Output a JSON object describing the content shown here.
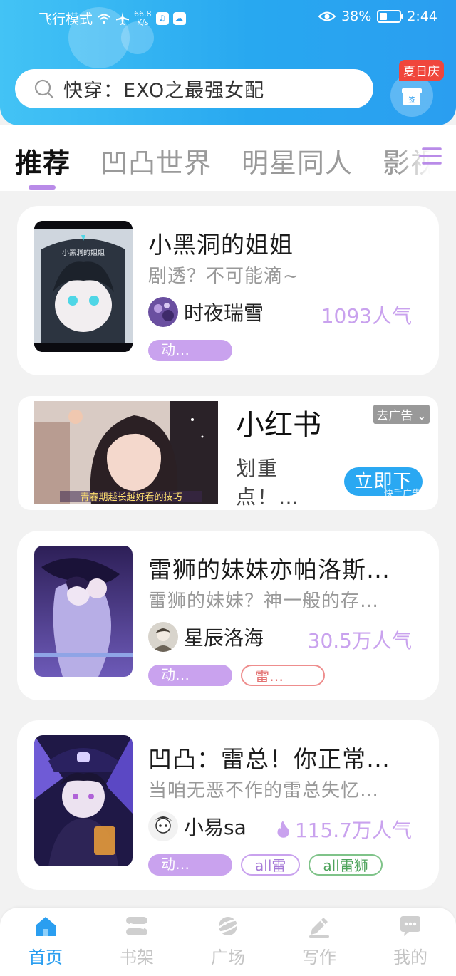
{
  "status_bar": {
    "airplane_mode": "飞行模式",
    "speed_value": "66.8",
    "speed_unit": "K/s",
    "battery_percent": "38%",
    "battery_level": 0.38,
    "time": "2:44"
  },
  "header": {
    "search_text": "快穿：EXO之最强女配",
    "sign_badge": "夏日庆",
    "sign_label": "签"
  },
  "tabs": [
    {
      "label": "推荐",
      "active": true
    },
    {
      "label": "凹凸世界"
    },
    {
      "label": "明星同人"
    },
    {
      "label": "影视"
    }
  ],
  "books": [
    {
      "title": "小黑洞的姐姐",
      "desc": "剧透？不可能滴~",
      "author": "时夜瑞雪",
      "popularity": "1093人气",
      "cover_text": "小黑洞的姐姐",
      "tags": [
        {
          "label": "动…",
          "style": "fill"
        }
      ]
    },
    {
      "title": "雷狮的妹妹亦帕洛斯…",
      "desc": "雷狮的妹妹？神一般的存…",
      "author": "星辰洛海",
      "popularity": "30.5万人气",
      "tags": [
        {
          "label": "动…",
          "style": "fill"
        },
        {
          "label": "雷…",
          "style": "red"
        }
      ]
    },
    {
      "title": "凹凸：雷总！你正常…",
      "desc": "当咱无恶不作的雷总失忆…",
      "author": "小易sa",
      "popularity": "115.7万人气",
      "hot": true,
      "tags": [
        {
          "label": "动…",
          "style": "fill"
        },
        {
          "label": "all雷",
          "style": "purple"
        },
        {
          "label": "all雷狮",
          "style": "green"
        }
      ]
    }
  ],
  "ad": {
    "title": "小红书",
    "desc": "划重点！…",
    "image_caption": "青春期越长越好看的技巧",
    "close_label": "去广告",
    "button": "立即下",
    "mark": "快手广告"
  },
  "nav": [
    {
      "label": "首页",
      "icon": "home-icon",
      "active": true
    },
    {
      "label": "书架",
      "icon": "bookshelf-icon"
    },
    {
      "label": "广场",
      "icon": "planet-icon"
    },
    {
      "label": "写作",
      "icon": "pen-icon"
    },
    {
      "label": "我的",
      "icon": "chat-icon"
    }
  ],
  "colors": {
    "header_blue": "#2aa8f0",
    "accent_purple": "#c9a2ee",
    "tag_red": "#ee8d8d",
    "tag_green": "#7fc389"
  }
}
